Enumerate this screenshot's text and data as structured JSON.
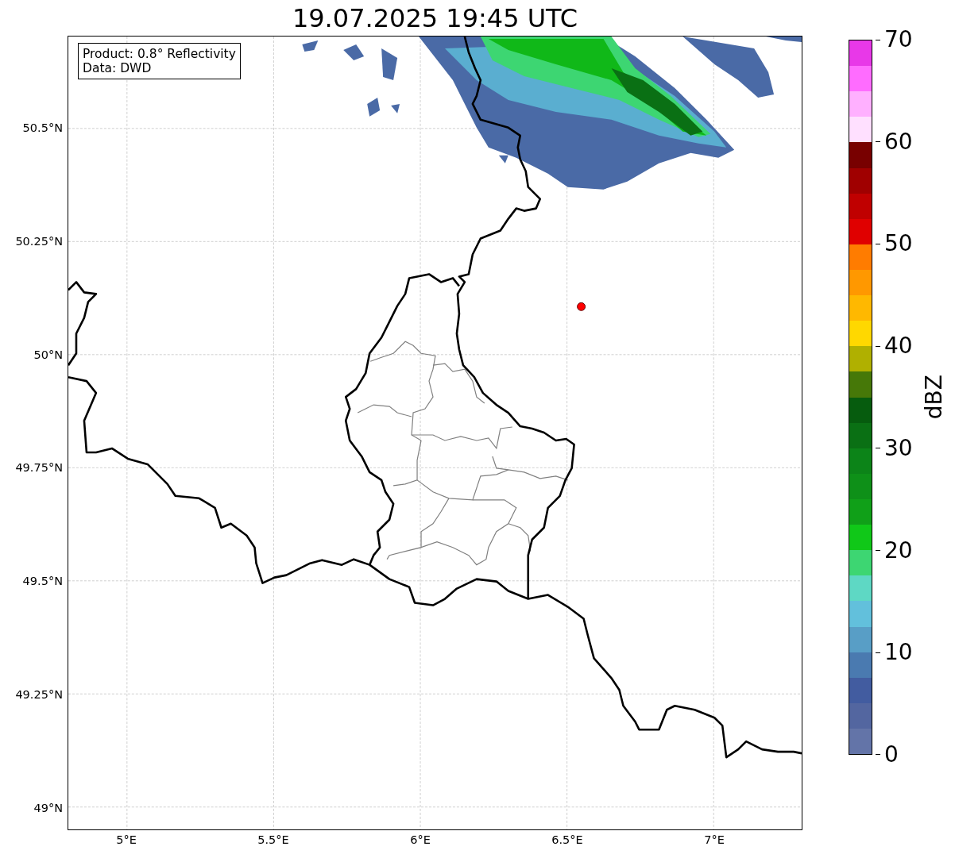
{
  "title": "19.07.2025 19:45 UTC",
  "info_box": {
    "lines": [
      "Product: 0.8° Reflectivity",
      "Data: DWD"
    ]
  },
  "map": {
    "lat_labels": [
      "50.5°N",
      "50.25°N",
      "50°N",
      "49.75°N",
      "49.5°N",
      "49.25°N",
      "49°N"
    ],
    "lon_labels": [
      "5°E",
      "5.5°E",
      "6°E",
      "6.5°E",
      "7°E"
    ]
  },
  "colorbar": {
    "label": "dBZ",
    "ticks": [
      "70",
      "60",
      "50",
      "40",
      "30",
      "20",
      "10",
      "0"
    ],
    "bands": [
      {
        "color": "#e838e8"
      },
      {
        "color": "#ff6cff"
      },
      {
        "color": "#ffb0ff"
      },
      {
        "color": "#ffe0ff"
      },
      {
        "color": "#780000"
      },
      {
        "color": "#a00000"
      },
      {
        "color": "#c00000"
      },
      {
        "color": "#e00000"
      },
      {
        "color": "#ff7c00"
      },
      {
        "color": "#ff9800"
      },
      {
        "color": "#ffb800"
      },
      {
        "color": "#ffd800"
      },
      {
        "color": "#b0b000"
      },
      {
        "color": "#467808"
      },
      {
        "color": "#065c0e"
      },
      {
        "color": "#0a7014"
      },
      {
        "color": "#0c8418"
      },
      {
        "color": "#0e9018"
      },
      {
        "color": "#10a018"
      },
      {
        "color": "#10c818"
      },
      {
        "color": "#3dd672"
      },
      {
        "color": "#5ed8c4"
      },
      {
        "color": "#62c0dc"
      },
      {
        "color": "#589ec6"
      },
      {
        "color": "#4a7ab0"
      },
      {
        "color": "#425ca0"
      },
      {
        "color": "#5366a0"
      },
      {
        "color": "#6374a8"
      }
    ]
  }
}
